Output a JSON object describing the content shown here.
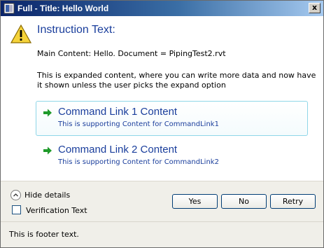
{
  "window": {
    "title": "Full - Title: Hello World",
    "close_glyph": "x"
  },
  "dialog": {
    "icon": "warning-icon",
    "instruction": "Instruction Text:",
    "main_content": "Main Content: Hello. Document = PipingTest2.rvt",
    "expanded_content": "This is expanded content, where you can write more data and now have it shown unless the user picks the expand option"
  },
  "command_links": [
    {
      "title": "Command Link 1 Content",
      "subtitle": "This is supporting Content for CommandLink1"
    },
    {
      "title": "Command Link 2 Content",
      "subtitle": "This is supporting Content for CommandLink2"
    }
  ],
  "controls": {
    "expander_label": "Hide details",
    "verification_label": "Verification Text",
    "verification_checked": false
  },
  "buttons": {
    "yes": "Yes",
    "no": "No",
    "retry": "Retry"
  },
  "footer": {
    "text": "This is footer text."
  },
  "colors": {
    "accent_text": "#1a3e9c",
    "link_border": "#8fd6e8",
    "arrow_green": "#1f9a2a",
    "title_bar": "#0a246a"
  }
}
